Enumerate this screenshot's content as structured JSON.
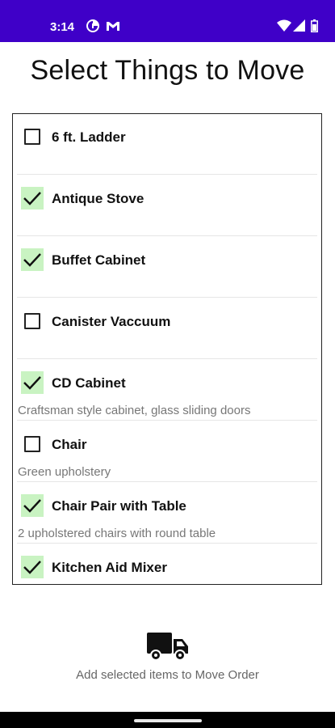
{
  "status_bar": {
    "time": "3:14",
    "background_color": "#3f00c8",
    "left_icons": [
      "data-saver-icon",
      "gmail-icon"
    ],
    "right_icons": [
      "wifi-icon",
      "signal-icon",
      "battery-icon"
    ]
  },
  "page": {
    "title": "Select Things to Move"
  },
  "items": [
    {
      "name": "6 ft. Ladder",
      "description": "",
      "checked": false
    },
    {
      "name": "Antique Stove",
      "description": "",
      "checked": true
    },
    {
      "name": "Buffet Cabinet",
      "description": "",
      "checked": true
    },
    {
      "name": "Canister Vaccuum",
      "description": "",
      "checked": false
    },
    {
      "name": "CD Cabinet",
      "description": "Craftsman style cabinet, glass sliding doors",
      "checked": true
    },
    {
      "name": "Chair",
      "description": "Green upholstery",
      "checked": false
    },
    {
      "name": "Chair Pair with Table",
      "description": "2 upholstered chairs with round table",
      "checked": true
    },
    {
      "name": "Kitchen Aid Mixer",
      "description": "",
      "checked": true
    }
  ],
  "move_action": {
    "label": "Add selected items to Move Order",
    "icon": "truck-icon"
  },
  "colors": {
    "checked_bg": "#c9f3c2",
    "accent": "#3f00c8"
  }
}
